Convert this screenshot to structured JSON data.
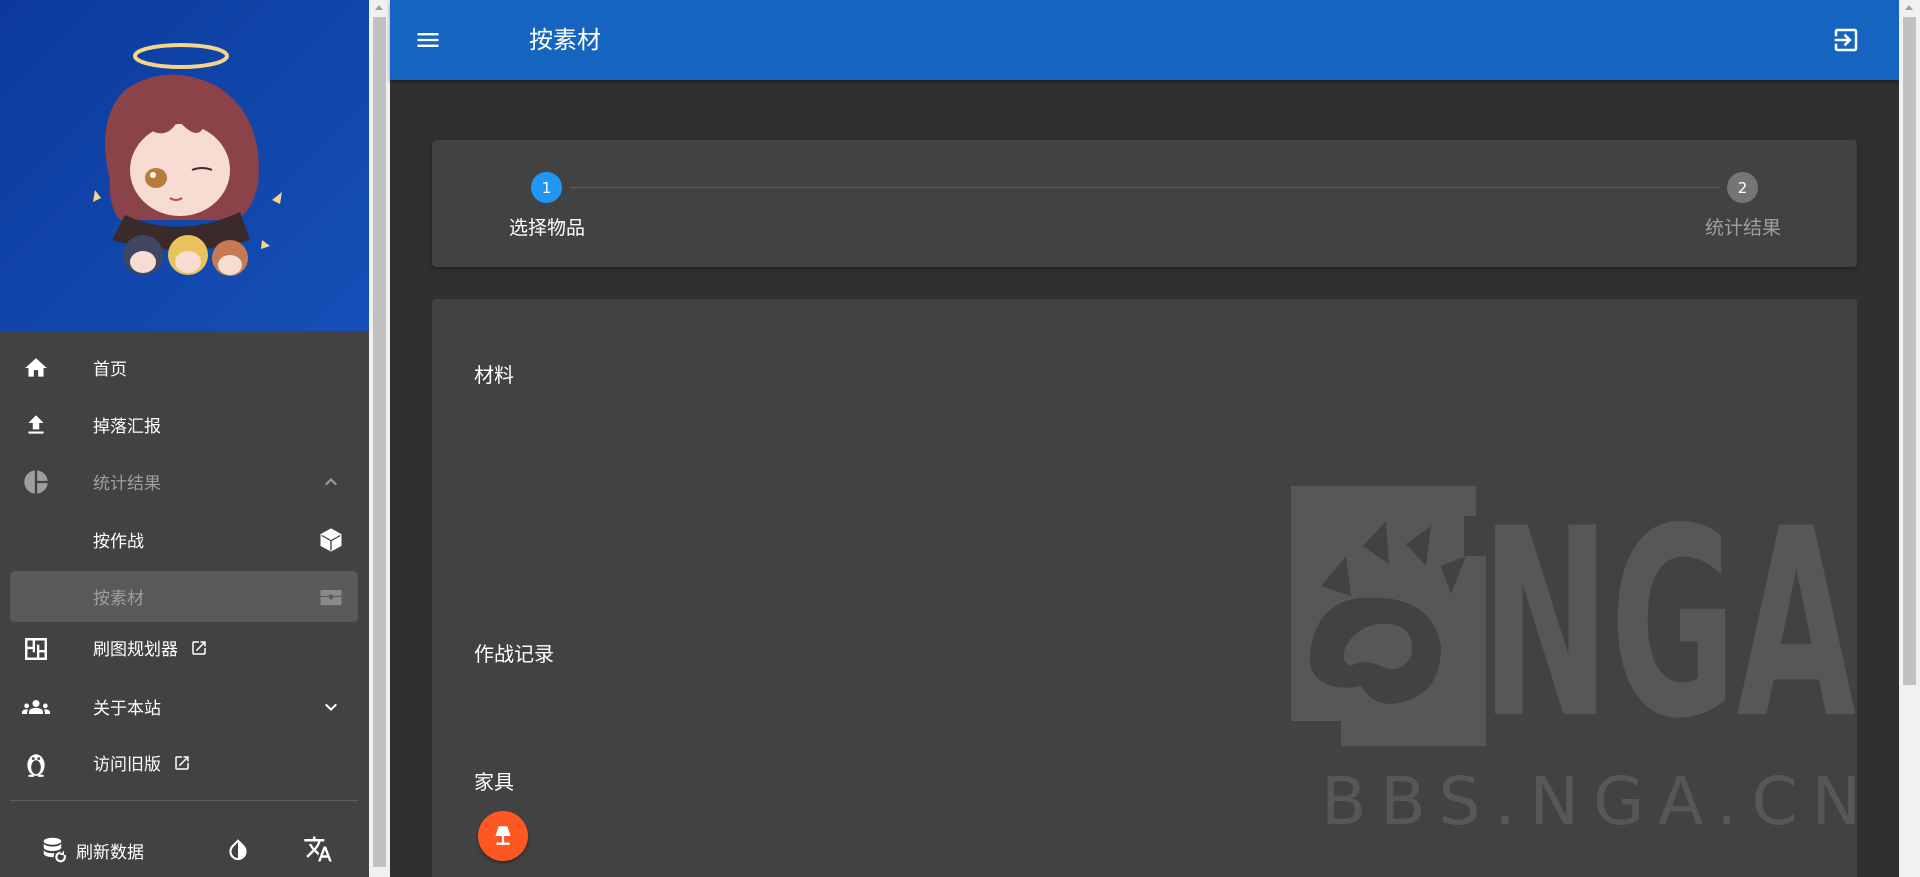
{
  "sidebar": {
    "nav": [
      {
        "label": "首页",
        "icon": "home-icon"
      },
      {
        "label": "掉落汇报",
        "icon": "upload-icon"
      },
      {
        "label": "统计结果",
        "icon": "pie-chart-icon",
        "trailing_icon": "chevron-up-icon"
      },
      {
        "label": "按作战",
        "icon": "",
        "trailing_icon": "cube-icon"
      },
      {
        "label": "按素材",
        "icon": "",
        "trailing_icon": "treasure-chest-icon"
      },
      {
        "label": "刷图规划器",
        "icon": "floor-plan-icon",
        "trailing_icon": "open-in-new-icon"
      },
      {
        "label": "关于本站",
        "icon": "account-group-icon",
        "trailing_icon": "chevron-down-icon"
      },
      {
        "label": "访问旧版",
        "icon": "penguin-icon",
        "trailing_icon": "open-in-new-icon"
      }
    ],
    "bottom": {
      "refresh_label": "刷新数据",
      "refresh_icon": "database-refresh-icon",
      "theme_icon": "invert-colors-icon",
      "language_icon": "translate-icon"
    }
  },
  "header": {
    "title": "按素材",
    "menu_icon": "menu-icon",
    "logout_icon": "logout-icon",
    "color": "#1565c0"
  },
  "stepper": {
    "steps": [
      {
        "number": "1",
        "label": "选择物品"
      },
      {
        "number": "2",
        "label": "统计结果"
      }
    ]
  },
  "main": {
    "sections": [
      {
        "title": "材料"
      },
      {
        "title": "作战记录"
      },
      {
        "title": "家具"
      }
    ],
    "furniture_item_icon": "lamp-icon",
    "watermark": {
      "logo_text": "NGA",
      "site_text": "BBS.NGA.CN"
    }
  },
  "colors": {
    "accent": "#2196f3",
    "furniture": "#ff5722",
    "sidebar_banner": "#0d47a1"
  }
}
